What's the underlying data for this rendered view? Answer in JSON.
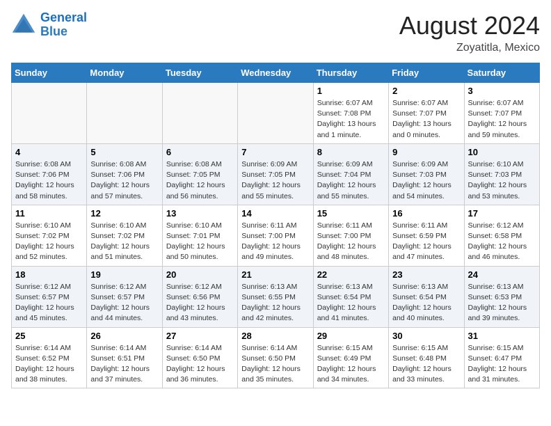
{
  "header": {
    "logo_line1": "General",
    "logo_line2": "Blue",
    "main_title": "August 2024",
    "subtitle": "Zoyatitla, Mexico"
  },
  "weekdays": [
    "Sunday",
    "Monday",
    "Tuesday",
    "Wednesday",
    "Thursday",
    "Friday",
    "Saturday"
  ],
  "weeks": [
    [
      {
        "day": "",
        "info": ""
      },
      {
        "day": "",
        "info": ""
      },
      {
        "day": "",
        "info": ""
      },
      {
        "day": "",
        "info": ""
      },
      {
        "day": "1",
        "info": "Sunrise: 6:07 AM\nSunset: 7:08 PM\nDaylight: 13 hours\nand 1 minute."
      },
      {
        "day": "2",
        "info": "Sunrise: 6:07 AM\nSunset: 7:07 PM\nDaylight: 13 hours\nand 0 minutes."
      },
      {
        "day": "3",
        "info": "Sunrise: 6:07 AM\nSunset: 7:07 PM\nDaylight: 12 hours\nand 59 minutes."
      }
    ],
    [
      {
        "day": "4",
        "info": "Sunrise: 6:08 AM\nSunset: 7:06 PM\nDaylight: 12 hours\nand 58 minutes."
      },
      {
        "day": "5",
        "info": "Sunrise: 6:08 AM\nSunset: 7:06 PM\nDaylight: 12 hours\nand 57 minutes."
      },
      {
        "day": "6",
        "info": "Sunrise: 6:08 AM\nSunset: 7:05 PM\nDaylight: 12 hours\nand 56 minutes."
      },
      {
        "day": "7",
        "info": "Sunrise: 6:09 AM\nSunset: 7:05 PM\nDaylight: 12 hours\nand 55 minutes."
      },
      {
        "day": "8",
        "info": "Sunrise: 6:09 AM\nSunset: 7:04 PM\nDaylight: 12 hours\nand 55 minutes."
      },
      {
        "day": "9",
        "info": "Sunrise: 6:09 AM\nSunset: 7:03 PM\nDaylight: 12 hours\nand 54 minutes."
      },
      {
        "day": "10",
        "info": "Sunrise: 6:10 AM\nSunset: 7:03 PM\nDaylight: 12 hours\nand 53 minutes."
      }
    ],
    [
      {
        "day": "11",
        "info": "Sunrise: 6:10 AM\nSunset: 7:02 PM\nDaylight: 12 hours\nand 52 minutes."
      },
      {
        "day": "12",
        "info": "Sunrise: 6:10 AM\nSunset: 7:02 PM\nDaylight: 12 hours\nand 51 minutes."
      },
      {
        "day": "13",
        "info": "Sunrise: 6:10 AM\nSunset: 7:01 PM\nDaylight: 12 hours\nand 50 minutes."
      },
      {
        "day": "14",
        "info": "Sunrise: 6:11 AM\nSunset: 7:00 PM\nDaylight: 12 hours\nand 49 minutes."
      },
      {
        "day": "15",
        "info": "Sunrise: 6:11 AM\nSunset: 7:00 PM\nDaylight: 12 hours\nand 48 minutes."
      },
      {
        "day": "16",
        "info": "Sunrise: 6:11 AM\nSunset: 6:59 PM\nDaylight: 12 hours\nand 47 minutes."
      },
      {
        "day": "17",
        "info": "Sunrise: 6:12 AM\nSunset: 6:58 PM\nDaylight: 12 hours\nand 46 minutes."
      }
    ],
    [
      {
        "day": "18",
        "info": "Sunrise: 6:12 AM\nSunset: 6:57 PM\nDaylight: 12 hours\nand 45 minutes."
      },
      {
        "day": "19",
        "info": "Sunrise: 6:12 AM\nSunset: 6:57 PM\nDaylight: 12 hours\nand 44 minutes."
      },
      {
        "day": "20",
        "info": "Sunrise: 6:12 AM\nSunset: 6:56 PM\nDaylight: 12 hours\nand 43 minutes."
      },
      {
        "day": "21",
        "info": "Sunrise: 6:13 AM\nSunset: 6:55 PM\nDaylight: 12 hours\nand 42 minutes."
      },
      {
        "day": "22",
        "info": "Sunrise: 6:13 AM\nSunset: 6:54 PM\nDaylight: 12 hours\nand 41 minutes."
      },
      {
        "day": "23",
        "info": "Sunrise: 6:13 AM\nSunset: 6:54 PM\nDaylight: 12 hours\nand 40 minutes."
      },
      {
        "day": "24",
        "info": "Sunrise: 6:13 AM\nSunset: 6:53 PM\nDaylight: 12 hours\nand 39 minutes."
      }
    ],
    [
      {
        "day": "25",
        "info": "Sunrise: 6:14 AM\nSunset: 6:52 PM\nDaylight: 12 hours\nand 38 minutes."
      },
      {
        "day": "26",
        "info": "Sunrise: 6:14 AM\nSunset: 6:51 PM\nDaylight: 12 hours\nand 37 minutes."
      },
      {
        "day": "27",
        "info": "Sunrise: 6:14 AM\nSunset: 6:50 PM\nDaylight: 12 hours\nand 36 minutes."
      },
      {
        "day": "28",
        "info": "Sunrise: 6:14 AM\nSunset: 6:50 PM\nDaylight: 12 hours\nand 35 minutes."
      },
      {
        "day": "29",
        "info": "Sunrise: 6:15 AM\nSunset: 6:49 PM\nDaylight: 12 hours\nand 34 minutes."
      },
      {
        "day": "30",
        "info": "Sunrise: 6:15 AM\nSunset: 6:48 PM\nDaylight: 12 hours\nand 33 minutes."
      },
      {
        "day": "31",
        "info": "Sunrise: 6:15 AM\nSunset: 6:47 PM\nDaylight: 12 hours\nand 31 minutes."
      }
    ]
  ]
}
